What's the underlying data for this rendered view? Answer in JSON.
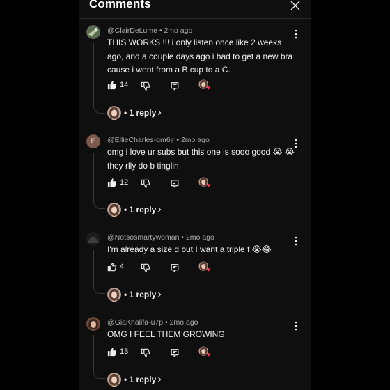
{
  "header": {
    "title": "Comments"
  },
  "comments": [
    {
      "author": "@ClairDeLume",
      "age": "2mo ago",
      "text": "THIS WORKS !!! i only listen once like 2 weeks ago, and a couple days ago i had to get a new bra cause i went from a B cup to a C.",
      "likes": "14",
      "liked": true,
      "reply_label": "1 reply"
    },
    {
      "author": "@EllieCharles-gm6jr",
      "age": "2mo ago",
      "avatar_letter": "E",
      "text": "omg i love ur subs but this one is sooo good 😭 😭 they rlly do b tinglin",
      "likes": "12",
      "liked": true,
      "reply_label": "1 reply"
    },
    {
      "author": "@Notsosmartywoman",
      "age": "2mo ago",
      "text": "I'm already a size d but I want a triple f 😭😂",
      "likes": "4",
      "liked": false,
      "reply_label": "1 reply"
    },
    {
      "author": "@GiaKhalifa-u7p",
      "age": "2mo ago",
      "text": "OMG I FEEL THEM GROWING",
      "likes": "13",
      "liked": true,
      "reply_label": "1 reply"
    }
  ],
  "colors": {
    "background": "#0f0f0f",
    "text": "#f1f1f1",
    "meta": "#aaaaaa",
    "heart": "#ff2d55"
  }
}
